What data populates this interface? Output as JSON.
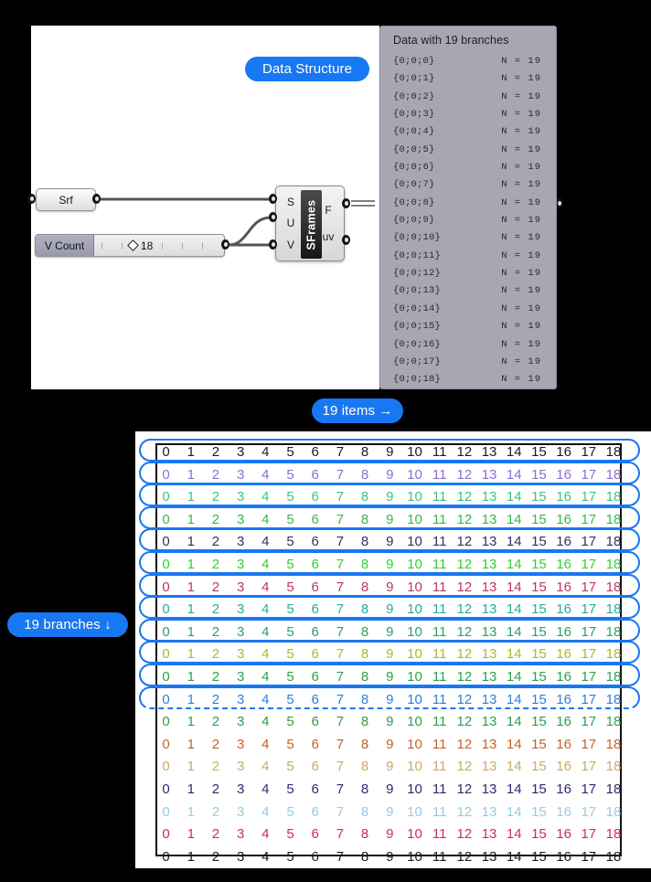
{
  "canvas": {
    "background_color": "#000000",
    "panel_color": "#ffffff"
  },
  "annotations": {
    "accent_color": "#1877f2",
    "data_structure_label": "Data Structure",
    "items_label": "19 items →",
    "branches_label": "19 branches ↓"
  },
  "definition": {
    "surface_param": {
      "label": "Srf"
    },
    "slider": {
      "label": "V Count",
      "value": "18"
    },
    "component": {
      "name": "SFrames",
      "inputs": [
        "S",
        "U",
        "V"
      ],
      "outputs": [
        "F",
        "uv"
      ]
    }
  },
  "data_viewer": {
    "title": "Data with 19 branches",
    "rows": [
      {
        "path": "{0;0;0}",
        "count": "N = 19"
      },
      {
        "path": "{0;0;1}",
        "count": "N = 19"
      },
      {
        "path": "{0;0;2}",
        "count": "N = 19"
      },
      {
        "path": "{0;0;3}",
        "count": "N = 19"
      },
      {
        "path": "{0;0;4}",
        "count": "N = 19"
      },
      {
        "path": "{0;0;5}",
        "count": "N = 19"
      },
      {
        "path": "{0;0;6}",
        "count": "N = 19"
      },
      {
        "path": "{0;0;7}",
        "count": "N = 19"
      },
      {
        "path": "{0;0;8}",
        "count": "N = 19"
      },
      {
        "path": "{0;0;9}",
        "count": "N = 19"
      },
      {
        "path": "{0;0;10}",
        "count": "N = 19"
      },
      {
        "path": "{0;0;11}",
        "count": "N = 19"
      },
      {
        "path": "{0;0;12}",
        "count": "N = 19"
      },
      {
        "path": "{0;0;13}",
        "count": "N = 19"
      },
      {
        "path": "{0;0;14}",
        "count": "N = 19"
      },
      {
        "path": "{0;0;15}",
        "count": "N = 19"
      },
      {
        "path": "{0;0;16}",
        "count": "N = 19"
      },
      {
        "path": "{0;0;17}",
        "count": "N = 19"
      },
      {
        "path": "{0;0;18}",
        "count": "N = 19"
      }
    ]
  },
  "grid": {
    "columns": [
      "0",
      "1",
      "2",
      "3",
      "4",
      "5",
      "6",
      "7",
      "8",
      "9",
      "10",
      "11",
      "12",
      "13",
      "14",
      "15",
      "16",
      "17",
      "18"
    ],
    "row_count": 19,
    "bracketed_rows": 12,
    "row_colors": [
      "#1a1a1a",
      "#8e6fc9",
      "#3fc088",
      "#35b94a",
      "#2e3166",
      "#37cc35",
      "#b83a5e",
      "#2aa9a0",
      "#2f9e5e",
      "#b2b52c",
      "#2f9e4e",
      "#2f7fd6",
      "#2f9e4e",
      "#c4622a",
      "#c9a96a",
      "#2b2a6e",
      "#9dc8e0",
      "#cf2b56",
      "#1a1a1a"
    ]
  }
}
